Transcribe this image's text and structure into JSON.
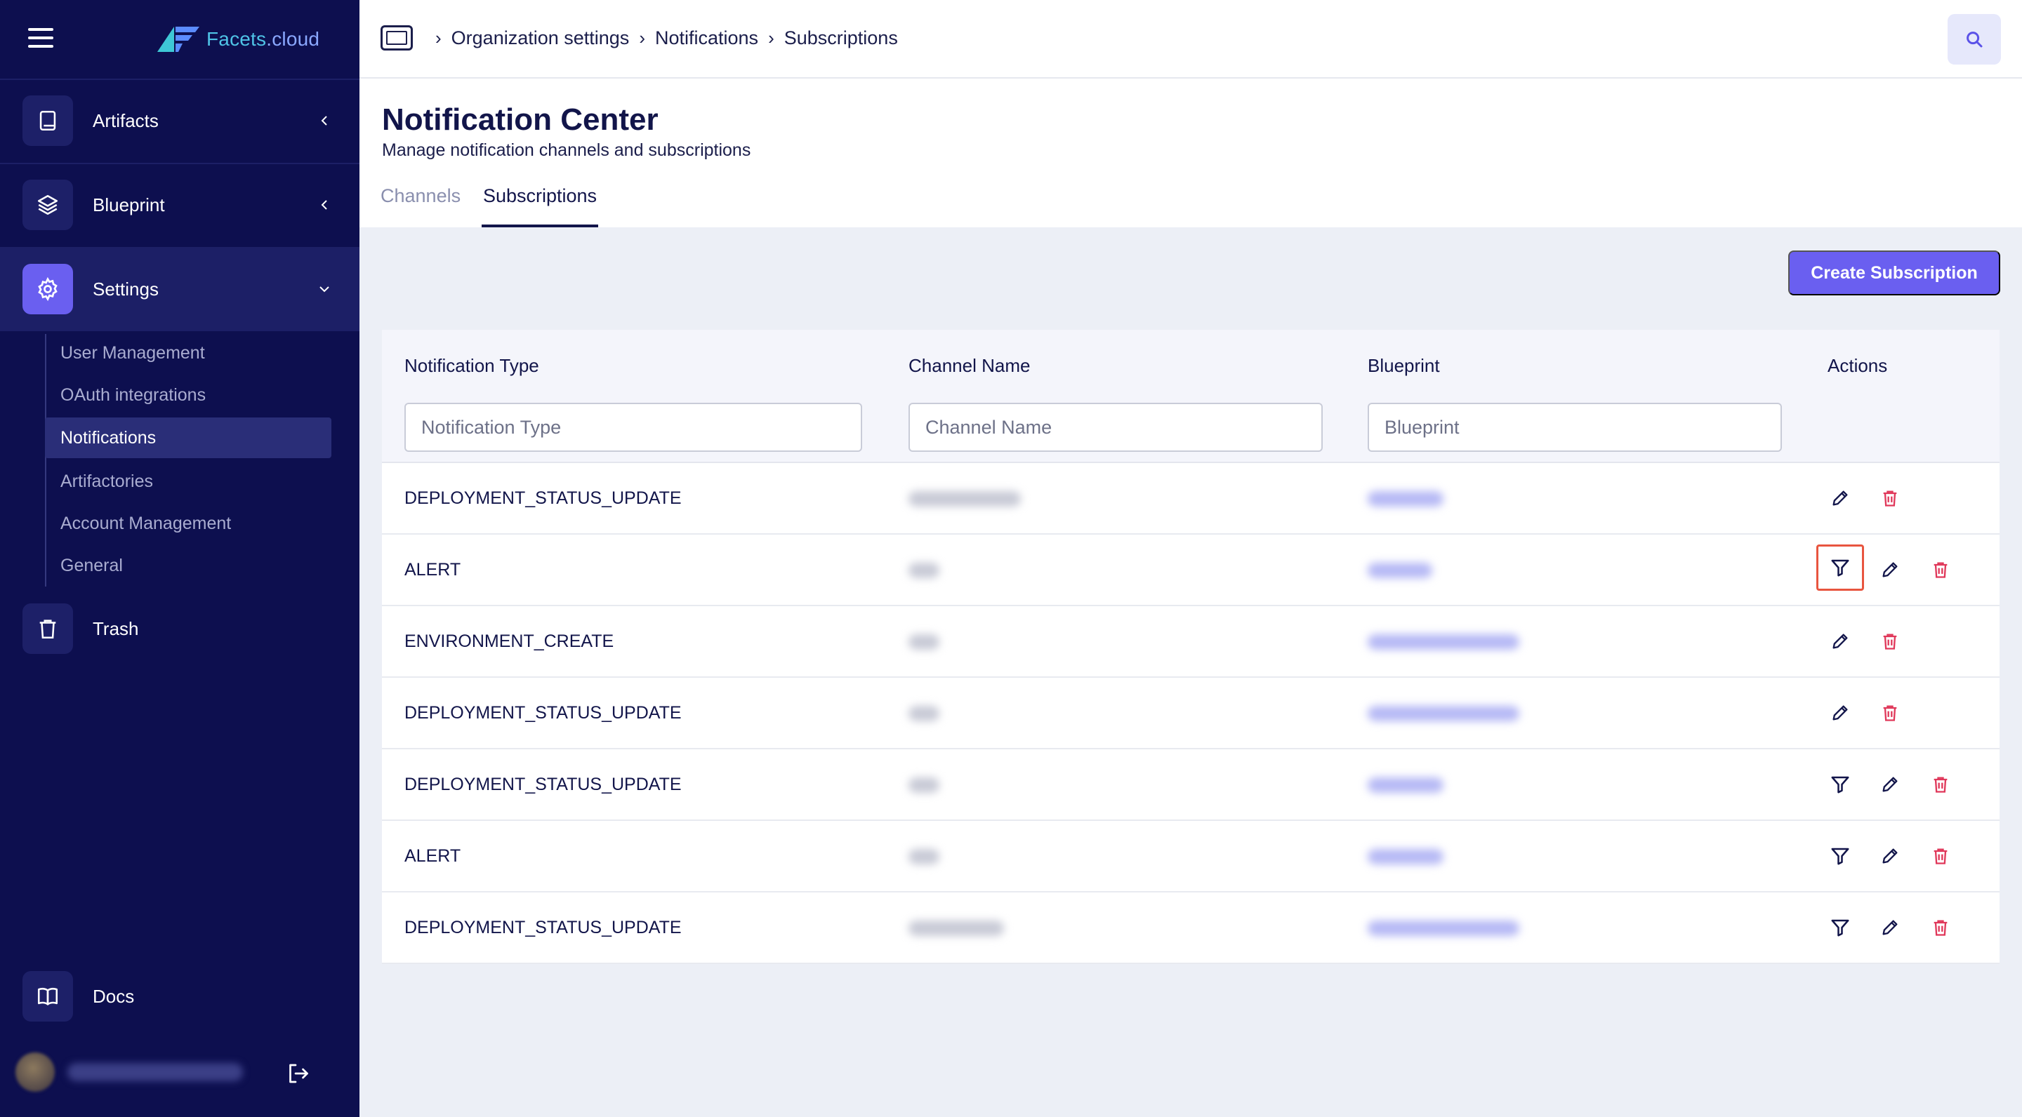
{
  "brand": {
    "name_part1": "Facets",
    "name_part2": ".cloud"
  },
  "sidebar": {
    "items": [
      {
        "label": "Artifacts",
        "icon": "book-icon"
      },
      {
        "label": "Blueprint",
        "icon": "layers-icon"
      },
      {
        "label": "Settings",
        "icon": "gear-icon"
      },
      {
        "label": "Trash",
        "icon": "trash-icon"
      }
    ],
    "settings_sub": [
      "User Management",
      "OAuth integrations",
      "Notifications",
      "Artifactories",
      "Account Management",
      "General"
    ],
    "docs_label": "Docs"
  },
  "breadcrumb": {
    "icon": "demo-icon",
    "items": [
      "Organization settings",
      "Notifications",
      "Subscriptions"
    ]
  },
  "page": {
    "title": "Notification Center",
    "subtitle": "Manage notification channels and subscriptions",
    "tabs": [
      "Channels",
      "Subscriptions"
    ],
    "active_tab": "Subscriptions",
    "create_button": "Create Subscription"
  },
  "table": {
    "columns": [
      "Notification Type",
      "Channel Name",
      "Blueprint",
      "Actions"
    ],
    "filters": {
      "type_placeholder": "Notification Type",
      "channel_placeholder": "Channel Name",
      "blueprint_placeholder": "Blueprint"
    },
    "rows": [
      {
        "type": "DEPLOYMENT_STATUS_UPDATE",
        "actions": [
          "edit",
          "delete"
        ]
      },
      {
        "type": "ALERT",
        "actions": [
          "filter",
          "edit",
          "delete"
        ],
        "highlighted_action": "filter"
      },
      {
        "type": "ENVIRONMENT_CREATE",
        "actions": [
          "edit",
          "delete"
        ]
      },
      {
        "type": "DEPLOYMENT_STATUS_UPDATE",
        "actions": [
          "edit",
          "delete"
        ]
      },
      {
        "type": "DEPLOYMENT_STATUS_UPDATE",
        "actions": [
          "filter",
          "edit",
          "delete"
        ]
      },
      {
        "type": "ALERT",
        "actions": [
          "filter",
          "edit",
          "delete"
        ]
      },
      {
        "type": "DEPLOYMENT_STATUS_UPDATE",
        "actions": [
          "filter",
          "edit",
          "delete"
        ]
      }
    ]
  },
  "colors": {
    "sidebar_bg": "#0d0f4f",
    "accent": "#6a5ff0",
    "delete": "#e0385a",
    "highlight": "#e8553f"
  }
}
